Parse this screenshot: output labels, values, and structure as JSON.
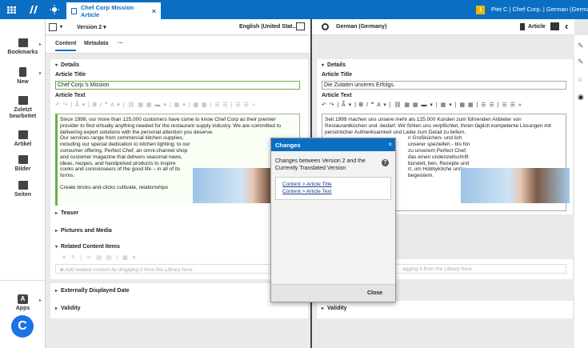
{
  "topbar": {
    "tab_title": "Chef Corp Mission Article",
    "notification_count": "1",
    "user_info": "Piet C | Chef Corp. | German (Germany)"
  },
  "leftnav": {
    "items": [
      {
        "label": "Bookmarks"
      },
      {
        "label": "New"
      },
      {
        "label": "Zuletzt bearbeitet"
      },
      {
        "label": "Artikel"
      },
      {
        "label": "Bilder"
      },
      {
        "label": "Seiten"
      }
    ],
    "apps_label": "Apps"
  },
  "left": {
    "version": "Version 2",
    "locale": "English (United Stat...",
    "tabs": [
      "Content",
      "Metadata",
      "···"
    ],
    "details": "Details",
    "article_title_label": "Article Title",
    "article_title": "Chef Corp.'s Mission",
    "article_text_label": "Article Text",
    "text_p1": "Since 1999, our more than 125,000 customers have come to know Chef Corp as their premier provider to find virtually anything needed for the restaurant supply industry. We are committed to delivering expert solutions with the personal attention you deserve.",
    "text_p2": "Our services range from commercial kitchen supplies, including our special dedication to kitchen lighting; to our consumer offering, Perfect Chef, an omni-channel shop and customer magazine that delivers seasonal news, ideas, recipes, and handpicked products to inspire cooks and connoisseurs of the good life – in all of its forms.",
    "text_p3": "Create bricks-and-clicks cultivate, relationships",
    "teaser": "Teaser",
    "pictures": "Pictures and Media",
    "related": "Related Content Items",
    "related_placeholder": "Add related content by dragging it from the Library here.",
    "ext_date": "Externally Displayed Date",
    "validity": "Validity"
  },
  "right": {
    "locale": "German (Germany)",
    "doc_type": "Article",
    "details": "Details",
    "article_title_label": "Article Title",
    "article_title": "Die Zutaten unseres Erfolgs.",
    "article_text_label": "Article Text",
    "text_p1": "Seit 1999 machen uns unsere mehr als 125.000 Kunden zum führenden Anbieter von Restaurantküchen und -bedarf. Wir fühlen uns verpflichtet, ihnen täglich kompetente Lösungen mit persönlicher Aufmerksamkeit und Liebe zum Detail zu liefern.",
    "text_p2": "n Großküchen- und lich unserer speziellen - bis hin zu unserem Perfect Chef, das einen undenzeitschrift bündelt, ben, Rezepte und rt, um Hobbyköche und u begeistern.",
    "related_placeholder": "agging it from the Library here.",
    "validity": "Validity"
  },
  "modal": {
    "title": "Changes",
    "subtitle": "Changes between Version 2 and the Currently Translated Version",
    "links": [
      "Content > Article Title",
      "Content > Article Text"
    ],
    "close": "Close"
  }
}
